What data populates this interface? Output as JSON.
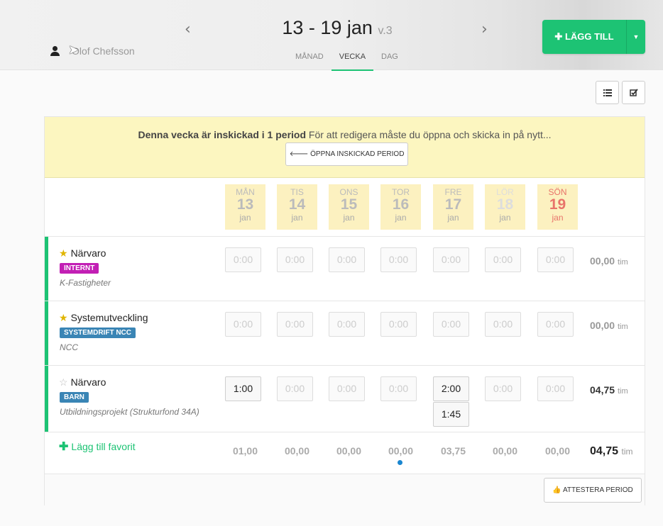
{
  "header": {
    "user_name": "Olof Chefsson",
    "prev_arrow": "‹",
    "next_arrow": "›",
    "week_title": "13 - 19 jan",
    "version": "v.3",
    "tabs": [
      "MÅNAD",
      "VECKA",
      "DAG"
    ],
    "active_tab": "VECKA",
    "add_label": "LÄGG TILL",
    "add_plus": "✚",
    "add_caret": "▼"
  },
  "toolbar": {
    "list_icon": "list-icon",
    "check_icon": "checkbox-edit-icon"
  },
  "notice": {
    "bold": "Denna vecka är inskickad i 1 period",
    "text": " För att redigera måste du öppna och skicka in på nytt...",
    "button": "🡐 ÖPPNA INSKICKAD PERIOD"
  },
  "days": [
    {
      "name": "MÅN",
      "date": "13",
      "month": "jan"
    },
    {
      "name": "TIS",
      "date": "14",
      "month": "jan"
    },
    {
      "name": "ONS",
      "date": "15",
      "month": "jan"
    },
    {
      "name": "TOR",
      "date": "16",
      "month": "jan"
    },
    {
      "name": "FRE",
      "date": "17",
      "month": "jan"
    },
    {
      "name": "LÖR",
      "date": "18",
      "month": "jan"
    },
    {
      "name": "SÖN",
      "date": "19",
      "month": "jan"
    }
  ],
  "rows": [
    {
      "name": "Närvaro",
      "starred": true,
      "tag": "INTERNT",
      "tag_color": "#c21fb4",
      "client": "K-Fastigheter",
      "cells": [
        "0:00",
        "0:00",
        "0:00",
        "0:00",
        "0:00",
        "0:00",
        "0:00"
      ],
      "total": "00,00",
      "unit": "tim"
    },
    {
      "name": "Systemutveckling",
      "starred": true,
      "tag": "SYSTEMDRIFT NCC",
      "tag_color": "#3a85b5",
      "client": "NCC",
      "cells": [
        "0:00",
        "0:00",
        "0:00",
        "0:00",
        "0:00",
        "0:00",
        "0:00"
      ],
      "total": "00,00",
      "unit": "tim"
    },
    {
      "name": "Närvaro",
      "starred": false,
      "tag": "BARN",
      "tag_color": "#3a85b5",
      "client": "Utbildningsprojekt (Strukturfond 34A)",
      "cells": [
        "1:00",
        "0:00",
        "0:00",
        "0:00",
        "2:00",
        "0:00",
        "0:00"
      ],
      "extra_cell": "1:45",
      "total": "04,75",
      "unit": "tim"
    }
  ],
  "summary": {
    "add_favorite": "Lägg till favorit",
    "day_totals": [
      "01,00",
      "00,00",
      "00,00",
      "00,00",
      "03,75",
      "00,00",
      "00,00"
    ],
    "total": "04,75",
    "unit": "tim"
  },
  "footer": {
    "attest_button": "ATTESTERA PERIOD"
  }
}
